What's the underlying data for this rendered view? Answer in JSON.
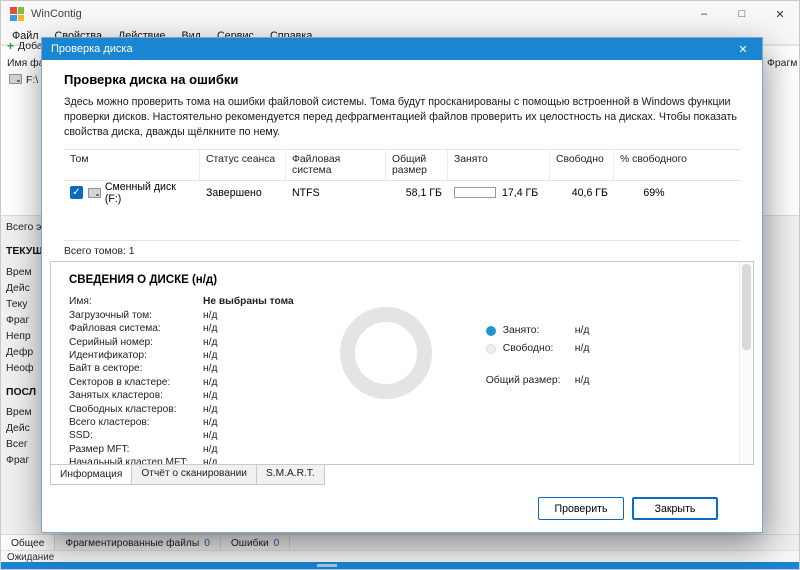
{
  "colors": {
    "accent_blue": "#1a86d2",
    "progress_green": "#3fae49",
    "legend_used": "#2196d3",
    "legend_free": "#ededed",
    "count_blue": "#0a66c2"
  },
  "window": {
    "title": "WinContig",
    "controls": {
      "minimize": "–",
      "maximize": "□",
      "close": "✕"
    },
    "menu": [
      "Файл",
      "Свойства",
      "Действие",
      "Вид",
      "Сервис",
      "Справка"
    ],
    "background": {
      "toolbar_add": "Доба",
      "add_icon": "+",
      "file_col": "Имя фай",
      "drive": "F:\\",
      "total": "Всего эл",
      "sec1": "ТЕКУЩ",
      "sec1_items": [
        "Врем",
        "Дейс",
        "Теку",
        "Фраг",
        "Непр",
        "Дефр",
        "Неоф"
      ],
      "sec2": "ПОСЛ",
      "sec2_items": [
        "Врем",
        "Дейс",
        "Всег",
        "Фраг"
      ],
      "right_col": "Фрагм"
    },
    "bottom_tabs": [
      {
        "label": "Общее",
        "count": ""
      },
      {
        "label": "Фрагментированные файлы",
        "count": "0"
      },
      {
        "label": "Ошибки",
        "count": "0"
      }
    ],
    "status": "Ожидание"
  },
  "dialog": {
    "title": "Проверка диска",
    "close_glyph": "✕",
    "heading": "Проверка диска на ошибки",
    "description": "Здесь можно проверить тома на ошибки файловой системы. Тома будут просканированы с помощью встроенной в Windows функции проверки дисков. Настоятельно рекомендуется перед дефрагментацией файлов проверить их целостность на дисках. Чтобы показать свойства диска, дважды щёлкните по нему.",
    "table": {
      "columns": [
        "Том",
        "Статус сеанса",
        "Файловая система",
        "Общий размер",
        "Занято",
        "Свободно",
        "% свободного"
      ],
      "rows": [
        {
          "check_glyph": "✓",
          "volume": "Сменный диск (F:)",
          "status": "Завершено",
          "filesystem": "NTFS",
          "total": "58,1 ГБ",
          "bar_style": "width:65%",
          "used": "17,4 ГБ",
          "free": "40,6 ГБ",
          "free_pct": "69%"
        }
      ]
    },
    "total_volumes": "Всего томов: 1",
    "details": {
      "heading": "СВЕДЕНИЯ О ДИСКЕ (н/д)",
      "fields": [
        {
          "label": "Имя:",
          "value": "Не выбраны тома"
        },
        {
          "label": "Загрузочный том:",
          "value": "н/д"
        },
        {
          "label": "Файловая система:",
          "value": "н/д"
        },
        {
          "label": "Серийный номер:",
          "value": "н/д"
        },
        {
          "label": "Идентификатор:",
          "value": "н/д"
        },
        {
          "label": "Байт в секторе:",
          "value": "н/д"
        },
        {
          "label": "Секторов в кластере:",
          "value": "н/д"
        },
        {
          "label": "Занятых кластеров:",
          "value": "н/д"
        },
        {
          "label": "Свободных кластеров:",
          "value": "н/д"
        },
        {
          "label": "Всего кластеров:",
          "value": "н/д"
        },
        {
          "label": "SSD:",
          "value": "н/д"
        },
        {
          "label": "Размер MFT:",
          "value": "н/д"
        },
        {
          "label": "Начальный кластер MFT:",
          "value": "н/д"
        }
      ],
      "legend": {
        "used_label": "Занято:",
        "used_value": "н/д",
        "free_label": "Свободно:",
        "free_value": "н/д",
        "total_label": "Общий размер:",
        "total_value": "н/д"
      }
    },
    "tabs": [
      "Информация",
      "Отчёт о сканировании",
      "S.M.A.R.T."
    ],
    "buttons": {
      "check": "Проверить",
      "close": "Закрыть"
    }
  }
}
